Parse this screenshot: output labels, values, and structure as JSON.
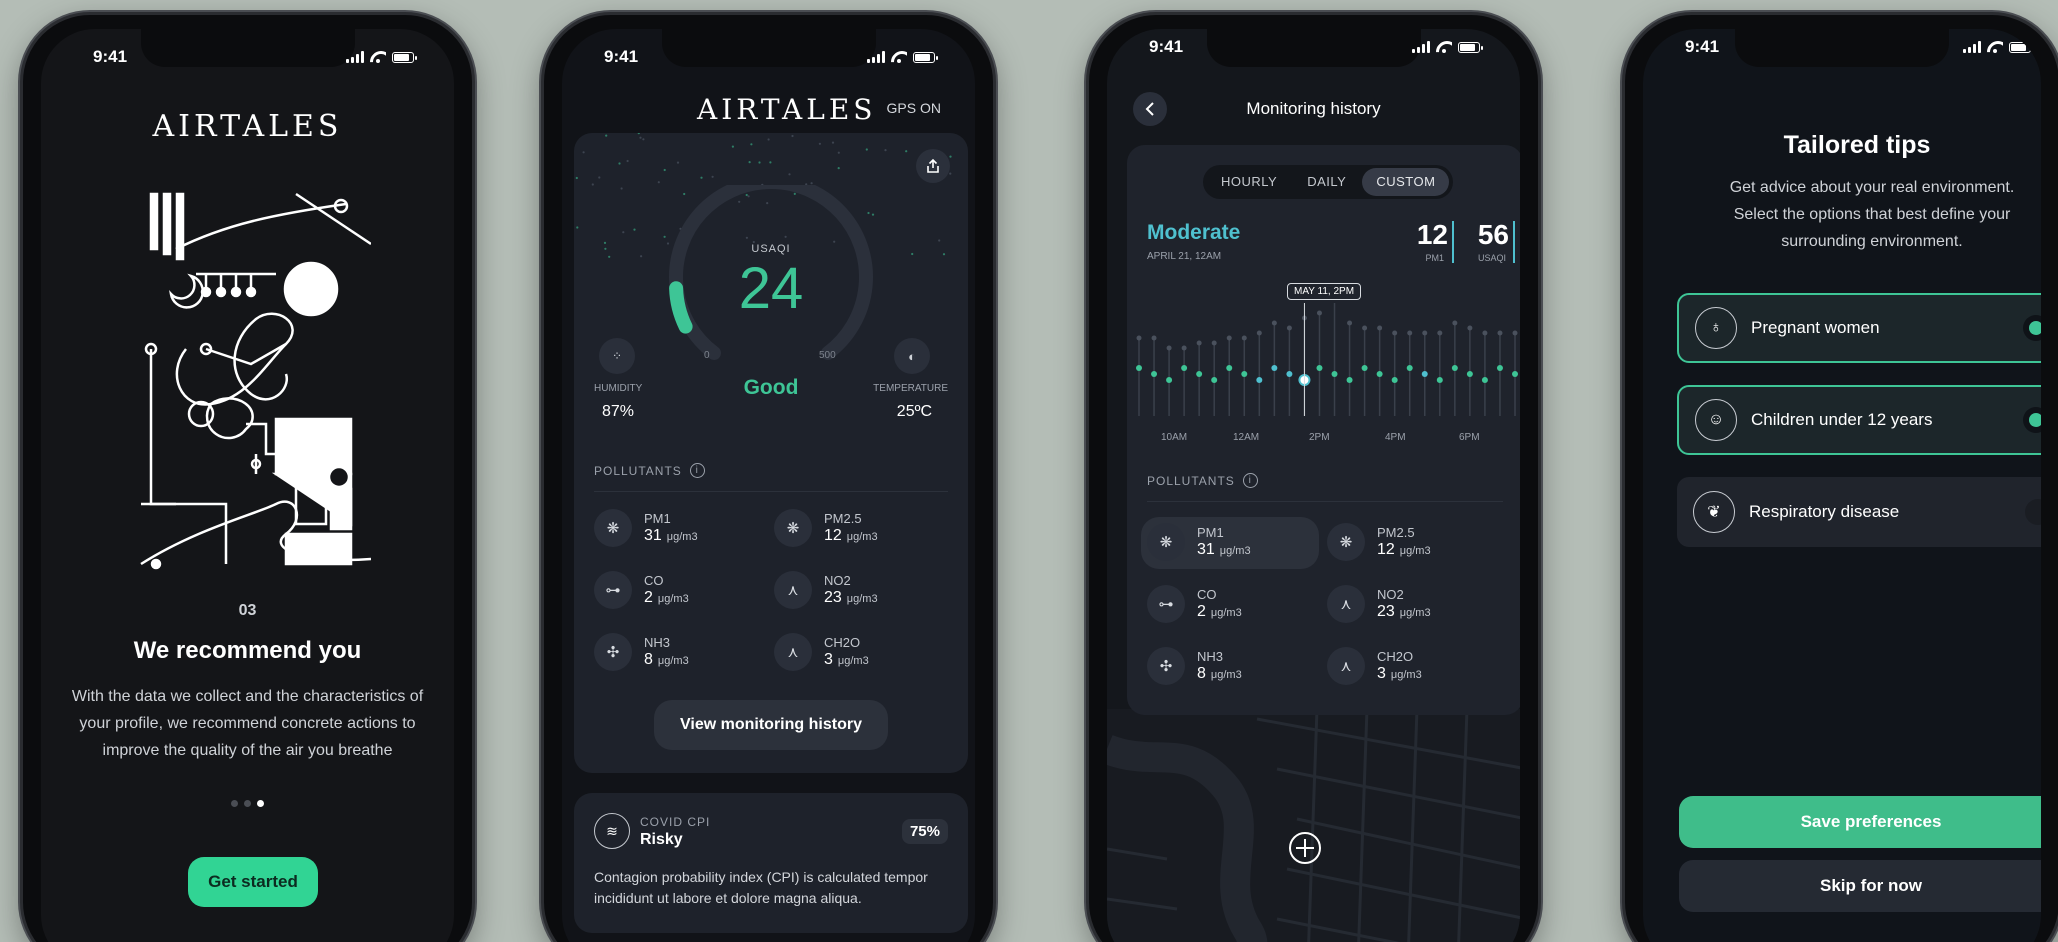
{
  "status_time": "9:41",
  "phone1": {
    "brand": "AIRTALES",
    "step": "03",
    "title": "We recommend you",
    "body": "With the data we collect and the characteristics of your profile, we recommend concrete actions to improve the quality of the air you breathe",
    "page_index": 2,
    "page_count": 3,
    "cta": "Get started"
  },
  "phone2": {
    "brand": "AIRTALES",
    "gps": "GPS ON",
    "gauge": {
      "label": "USAQI",
      "value": "24",
      "min": "0",
      "max": "500",
      "status": "Good",
      "fill_fraction": 0.048
    },
    "humidity": {
      "label": "HUMIDITY",
      "value": "87%"
    },
    "temperature": {
      "label": "TEMPERATURE",
      "value": "25ºC"
    },
    "pollutants_heading": "POLLUTANTS",
    "pollutants": [
      {
        "name": "PM1",
        "value": "31",
        "unit": "μg/m3",
        "icon": "particles-icon"
      },
      {
        "name": "PM2.5",
        "value": "12",
        "unit": "μg/m3",
        "icon": "particles-icon"
      },
      {
        "name": "CO",
        "value": "2",
        "unit": "μg/m3",
        "icon": "molecule-icon"
      },
      {
        "name": "NO2",
        "value": "23",
        "unit": "μg/m3",
        "icon": "molecule-icon"
      },
      {
        "name": "NH3",
        "value": "8",
        "unit": "μg/m3",
        "icon": "molecule-icon"
      },
      {
        "name": "CH2O",
        "value": "3",
        "unit": "μg/m3",
        "icon": "molecule-icon"
      }
    ],
    "history_button": "View monitoring history",
    "covid": {
      "label": "COVID CPI",
      "status": "Risky",
      "percent": "75%",
      "description": "Contagion probability index (CPI) is calculated tempor incididunt ut labore et dolore magna aliqua."
    }
  },
  "phone3": {
    "title": "Monitoring history",
    "tabs": [
      "HOURLY",
      "DAILY",
      "CUSTOM"
    ],
    "active_tab": "CUSTOM",
    "status": "Moderate",
    "date": "APRIL 21, 12AM",
    "pm1_value": "12",
    "pm1_label": "PM1",
    "usaqi_value": "56",
    "usaqi_label": "USAQI",
    "tooltip": "MAY 11, 2PM",
    "x_ticks": [
      "10AM",
      "12AM",
      "2PM",
      "4PM",
      "6PM"
    ],
    "pollutants_heading": "POLLUTANTS",
    "pollutants": [
      {
        "name": "PM1",
        "value": "31",
        "unit": "μg/m3"
      },
      {
        "name": "PM2.5",
        "value": "12",
        "unit": "μg/m3"
      },
      {
        "name": "CO",
        "value": "2",
        "unit": "μg/m3"
      },
      {
        "name": "NO2",
        "value": "23",
        "unit": "μg/m3"
      },
      {
        "name": "NH3",
        "value": "8",
        "unit": "μg/m3"
      },
      {
        "name": "CH2O",
        "value": "3",
        "unit": "μg/m3"
      }
    ]
  },
  "phone4": {
    "title": "Tailored tips",
    "subtitle": "Get advice about your real environment. Select the options that best define your surrounding environment.",
    "options": [
      {
        "label": "Pregnant women",
        "selected": true
      },
      {
        "label": "Children under 12 years",
        "selected": true
      },
      {
        "label": "Respiratory disease",
        "selected": false
      }
    ],
    "save_button": "Save preferences",
    "skip_button": "Skip for now"
  },
  "colors": {
    "accent": "#3ec596",
    "background": "#b4bdb6",
    "screen": "#111318",
    "card": "#1e222b"
  }
}
